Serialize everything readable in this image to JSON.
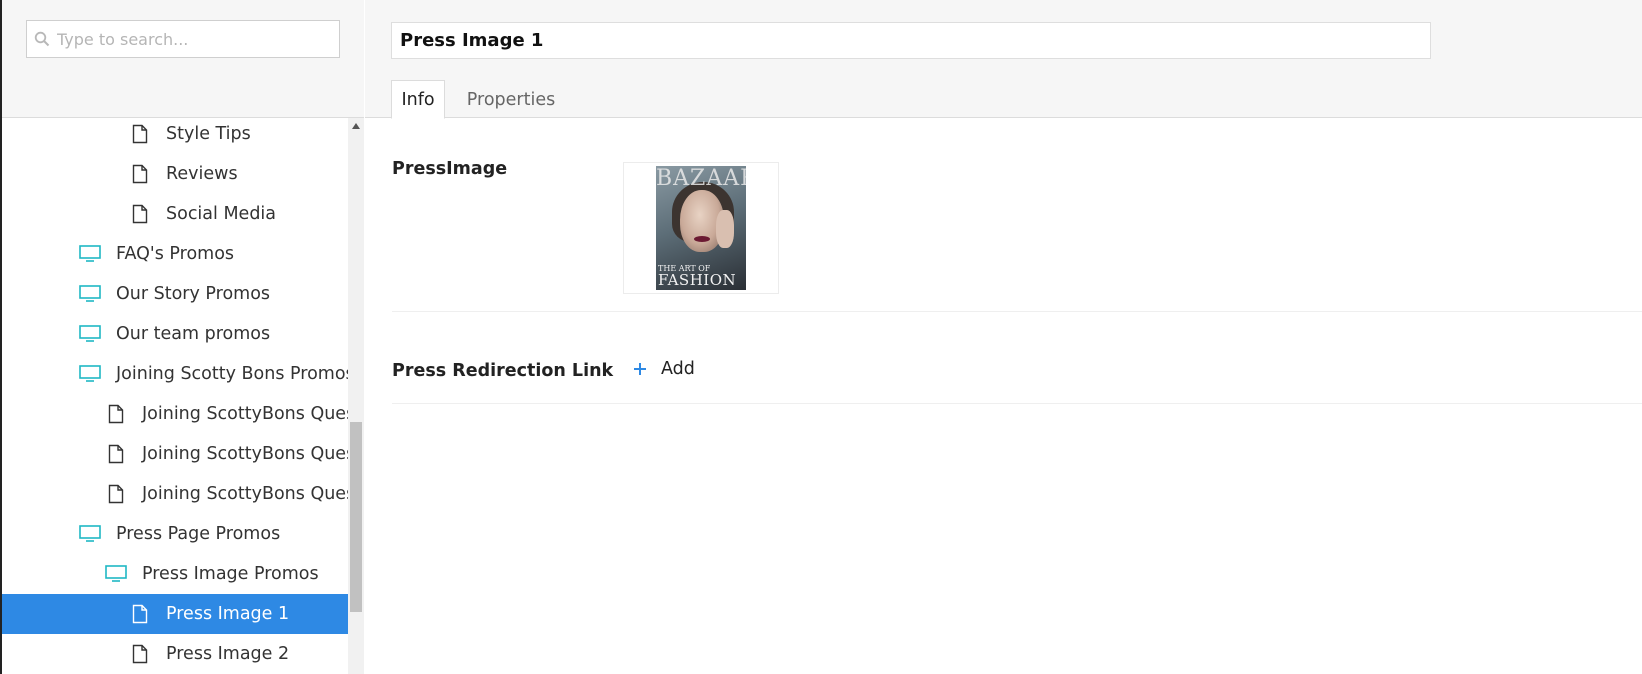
{
  "search": {
    "placeholder": "Type to search..."
  },
  "tree": {
    "items": [
      {
        "label": "Style Tips",
        "icon": "document-icon"
      },
      {
        "label": "Reviews",
        "icon": "document-icon"
      },
      {
        "label": "Social Media",
        "icon": "document-icon"
      },
      {
        "label": "FAQ's Promos",
        "icon": "monitor-icon"
      },
      {
        "label": "Our Story Promos",
        "icon": "monitor-icon"
      },
      {
        "label": "Our team promos",
        "icon": "monitor-icon"
      },
      {
        "label": "Joining Scotty Bons Promos",
        "icon": "monitor-icon"
      },
      {
        "label": "Joining ScottyBons Questions",
        "icon": "document-icon"
      },
      {
        "label": "Joining ScottyBons Questions",
        "icon": "document-icon"
      },
      {
        "label": "Joining ScottyBons Questions",
        "icon": "document-icon"
      },
      {
        "label": "Press Page Promos",
        "icon": "monitor-icon"
      },
      {
        "label": "Press Image Promos",
        "icon": "monitor-icon"
      },
      {
        "label": "Press Image 1",
        "icon": "document-icon",
        "selected": true
      },
      {
        "label": "Press Image 2",
        "icon": "document-icon"
      }
    ]
  },
  "editor": {
    "title_value": "Press Image 1",
    "tabs": [
      {
        "label": "Info",
        "active": true
      },
      {
        "label": "Properties",
        "active": false
      }
    ]
  },
  "properties": {
    "press_image_label": "PressImage",
    "press_image_cover": {
      "masthead": "BAZAAR",
      "cover_line_1": "THE ART OF",
      "cover_line_2": "FASHION"
    },
    "redirect_label": "Press Redirection Link",
    "add_label": "Add"
  },
  "colors": {
    "selection": "#2e89e4",
    "monitor_icon": "#1fb8c4",
    "add_icon": "#2e89e4"
  }
}
